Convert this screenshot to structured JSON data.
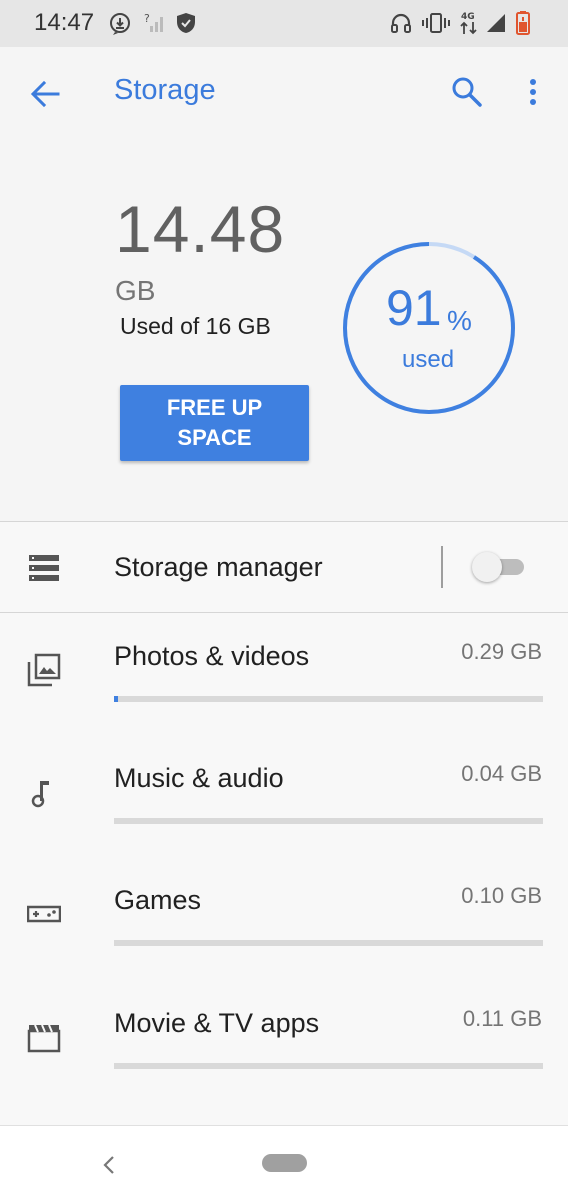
{
  "status_bar": {
    "time": "14:47",
    "icons": [
      "download-icon",
      "no-signal-icon",
      "shield-icon",
      "headset-icon",
      "vibrate-icon",
      "4g-data-icon",
      "signal-icon",
      "battery-icon"
    ],
    "network_label": "4G"
  },
  "app_bar": {
    "title": "Storage",
    "icons": [
      "back-arrow-icon",
      "search-icon",
      "more-vert-icon"
    ]
  },
  "summary": {
    "used_amount": "14.48",
    "used_unit": "GB",
    "used_of": "Used of 16 GB",
    "free_up_label": "FREE UP SPACE",
    "percent": "91",
    "percent_sign": "%",
    "percent_label": "used",
    "percent_value": 0.91
  },
  "storage_manager": {
    "label": "Storage manager",
    "enabled": false
  },
  "categories": [
    {
      "label": "Photos & videos",
      "size": "0.29 GB",
      "icon": "photo-library-icon",
      "fraction": 0.01
    },
    {
      "label": "Music & audio",
      "size": "0.04 GB",
      "icon": "music-note-icon",
      "fraction": 0.0
    },
    {
      "label": "Games",
      "size": "0.10 GB",
      "icon": "gamepad-icon",
      "fraction": 0.0
    },
    {
      "label": "Movie & TV apps",
      "size": "0.11 GB",
      "icon": "movie-icon",
      "fraction": 0.0
    }
  ],
  "colors": {
    "accent": "#3f80e0",
    "accent_light": "#c5d9f5",
    "status_bar": "#e6e6e6",
    "background": "#f5f5f5",
    "battery": "#e0552f"
  }
}
